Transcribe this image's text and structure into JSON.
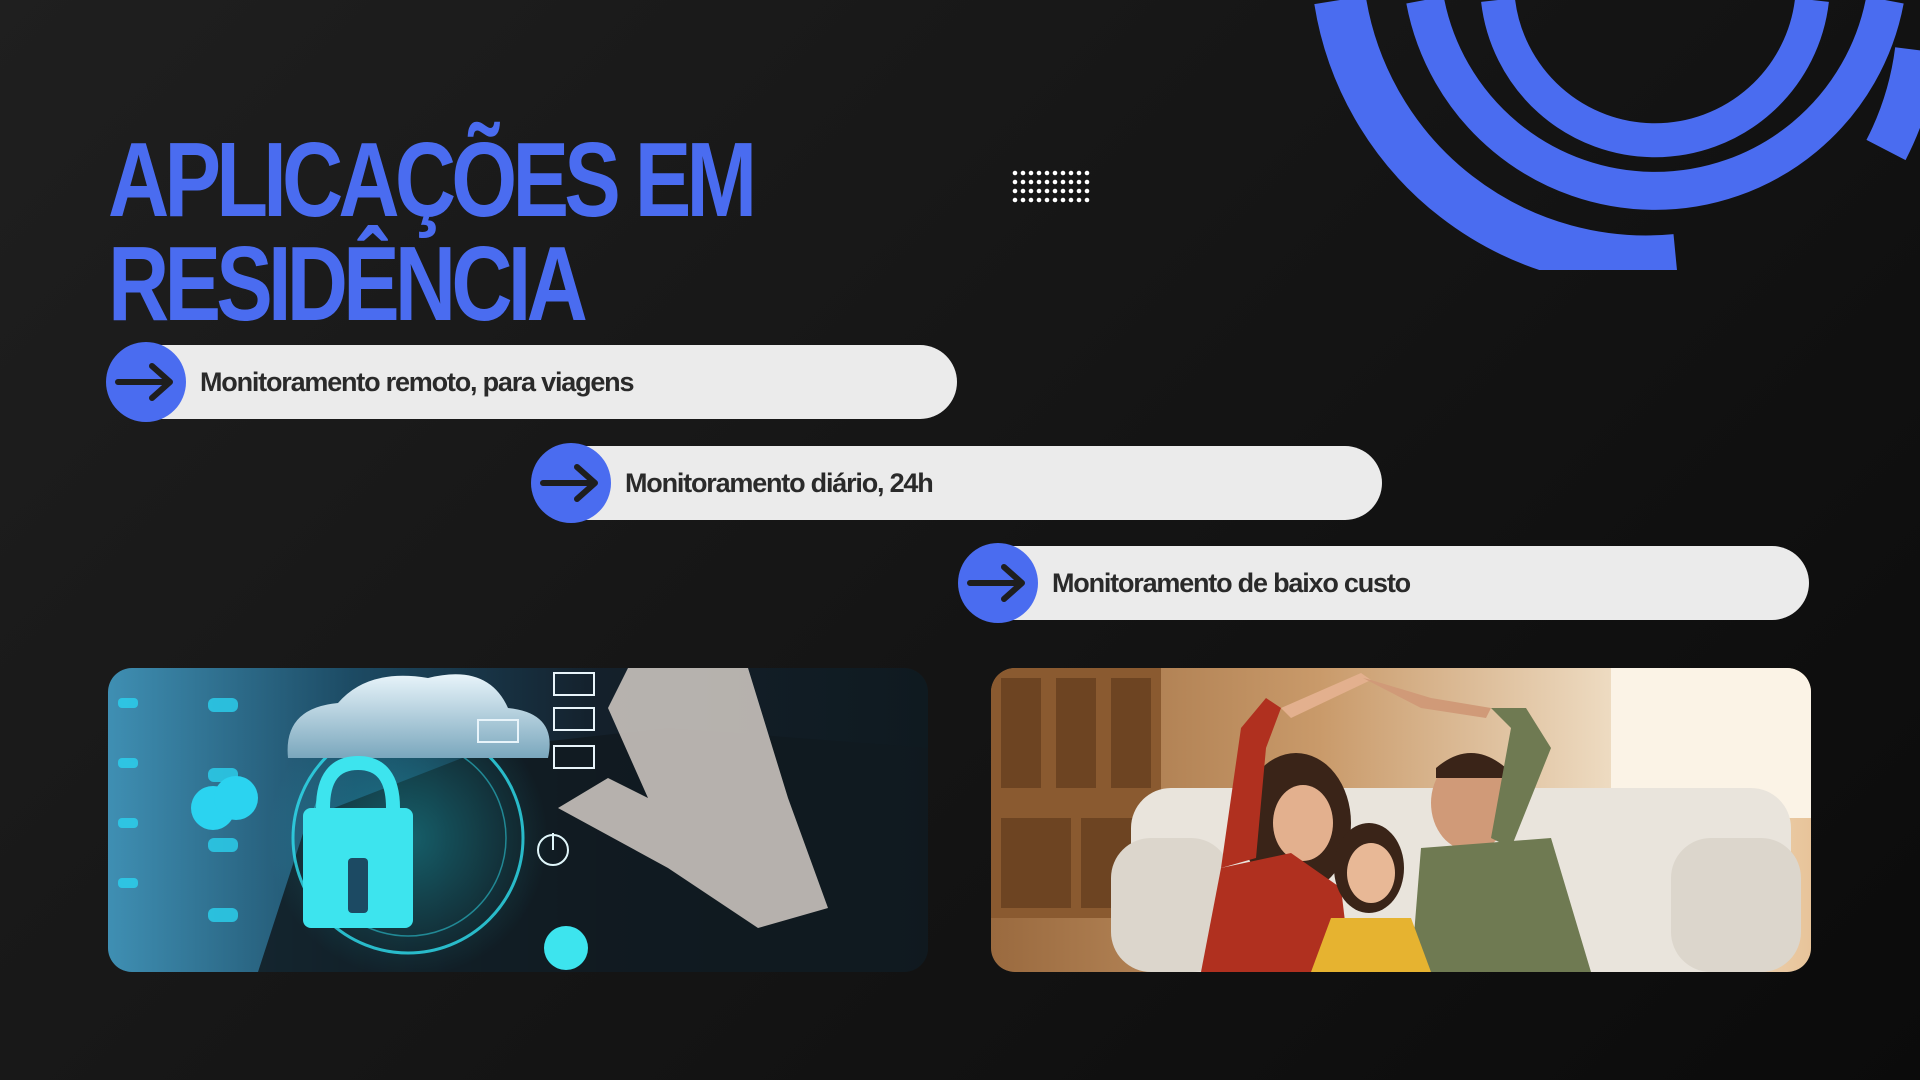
{
  "slide": {
    "title_lines": [
      "APLICAÇÕES EM",
      "RESIDÊNCIA"
    ],
    "items": [
      {
        "label": "Monitoramento remoto, para viagens"
      },
      {
        "label": "Monitoramento diário,  24h"
      },
      {
        "label": "Monitoramento de baixo custo"
      }
    ],
    "images": [
      {
        "icon": "cloud-security-lock-photo"
      },
      {
        "icon": "family-home-protection-photo"
      }
    ]
  },
  "colors": {
    "accent": "#4a6cf0",
    "background": "#161616",
    "pill": "#ebebeb",
    "pill_text": "#2a2a2a"
  }
}
